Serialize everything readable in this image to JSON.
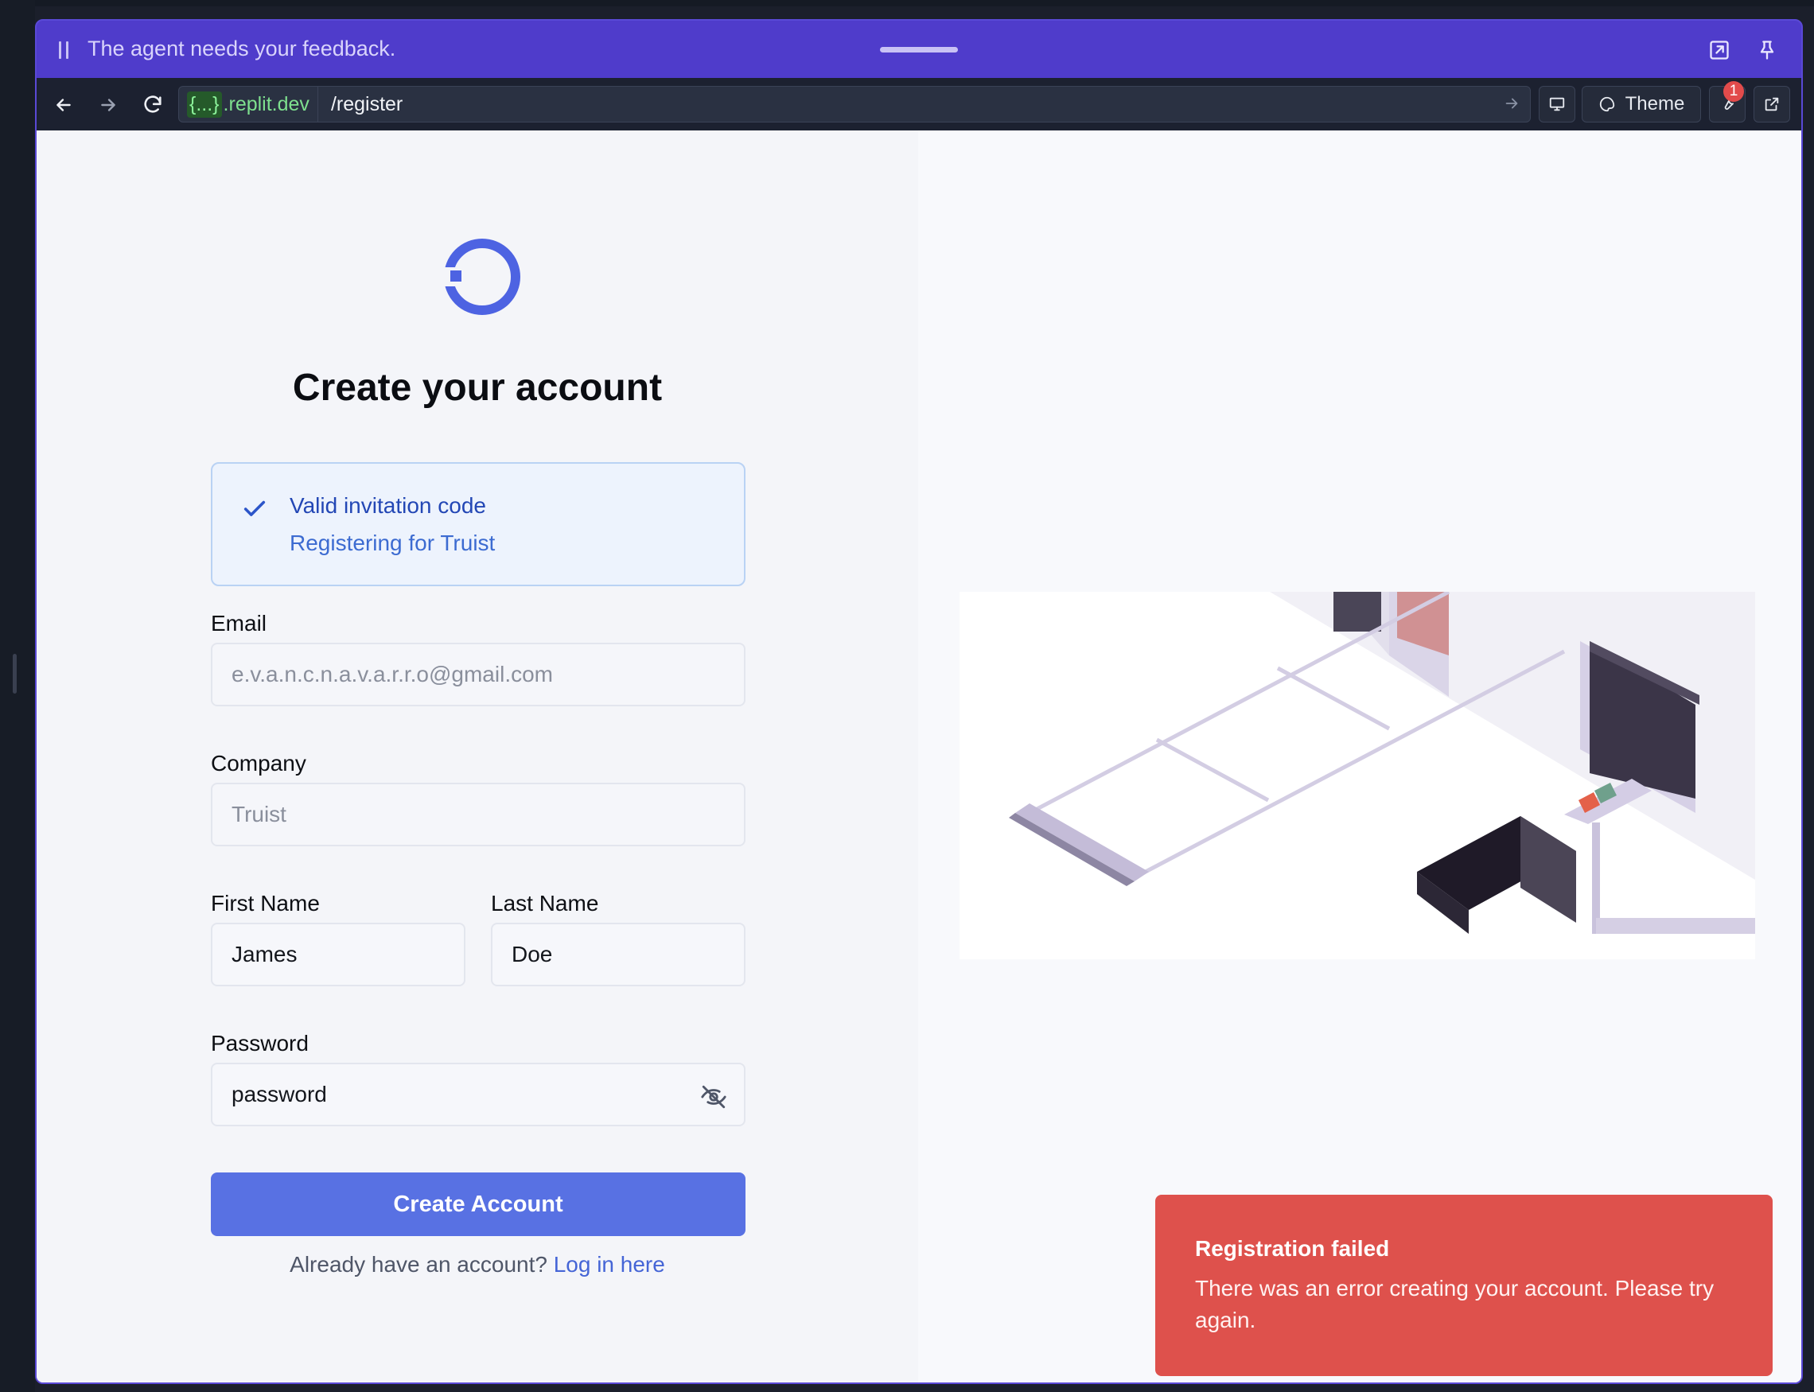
{
  "feedback_bar": {
    "message": "The agent needs your feedback."
  },
  "toolbar": {
    "url_host_prefix": "{...}",
    "url_host_suffix": ".replit.dev",
    "url_path": "/register",
    "theme_label": "Theme",
    "devtools_badge": "1"
  },
  "auth": {
    "heading": "Create your account",
    "invite": {
      "title": "Valid invitation code",
      "subtitle": "Registering for Truist"
    },
    "email": {
      "label": "Email",
      "placeholder": "e.v.a.n.c.n.a.v.a.r.r.o@gmail.com"
    },
    "company": {
      "label": "Company",
      "placeholder": "Truist"
    },
    "first_name": {
      "label": "First Name",
      "value": "James"
    },
    "last_name": {
      "label": "Last Name",
      "value": "Doe"
    },
    "password": {
      "label": "Password",
      "value": "password"
    },
    "submit_label": "Create Account",
    "login_prompt": "Already have an account?",
    "login_link": "Log in here"
  },
  "toast": {
    "title": "Registration failed",
    "message": "There was an error creating your account. Please try again."
  },
  "colors": {
    "brand": "#4f3ccb",
    "primary_button": "#5871e3",
    "error": "#de514c"
  }
}
